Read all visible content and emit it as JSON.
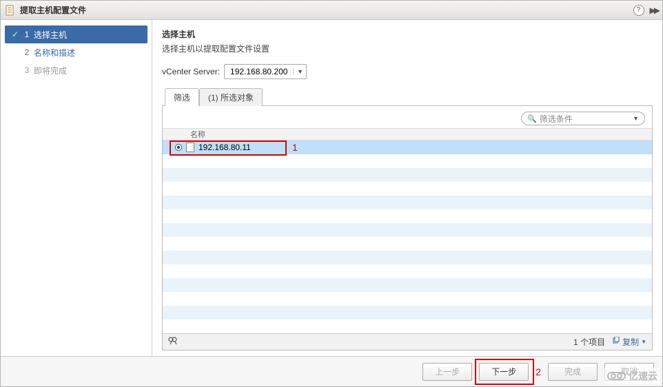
{
  "titlebar": {
    "title": "提取主机配置文件"
  },
  "sidebar": {
    "steps": [
      {
        "num": "1",
        "label": "选择主机",
        "check": "✓"
      },
      {
        "num": "2",
        "label": "名称和描述",
        "check": ""
      },
      {
        "num": "3",
        "label": "即将完成",
        "check": ""
      }
    ]
  },
  "main": {
    "title": "选择主机",
    "desc": "选择主机以提取配置文件设置",
    "server_label": "vCenter Server:",
    "server_value": "192.168.80.200",
    "tabs": {
      "filter": "筛选",
      "selected": "(1) 所选对象"
    },
    "filter_placeholder": "筛选条件",
    "column_header": "名称",
    "hosts": [
      {
        "name": "192.168.80.11"
      }
    ],
    "item_count": "1 个项目",
    "copy_label": "复制"
  },
  "annotations": {
    "one": "1",
    "two": "2"
  },
  "footer": {
    "back": "上一步",
    "next": "下一步",
    "finish": "完成",
    "cancel": "取消"
  },
  "watermark": "亿速云"
}
